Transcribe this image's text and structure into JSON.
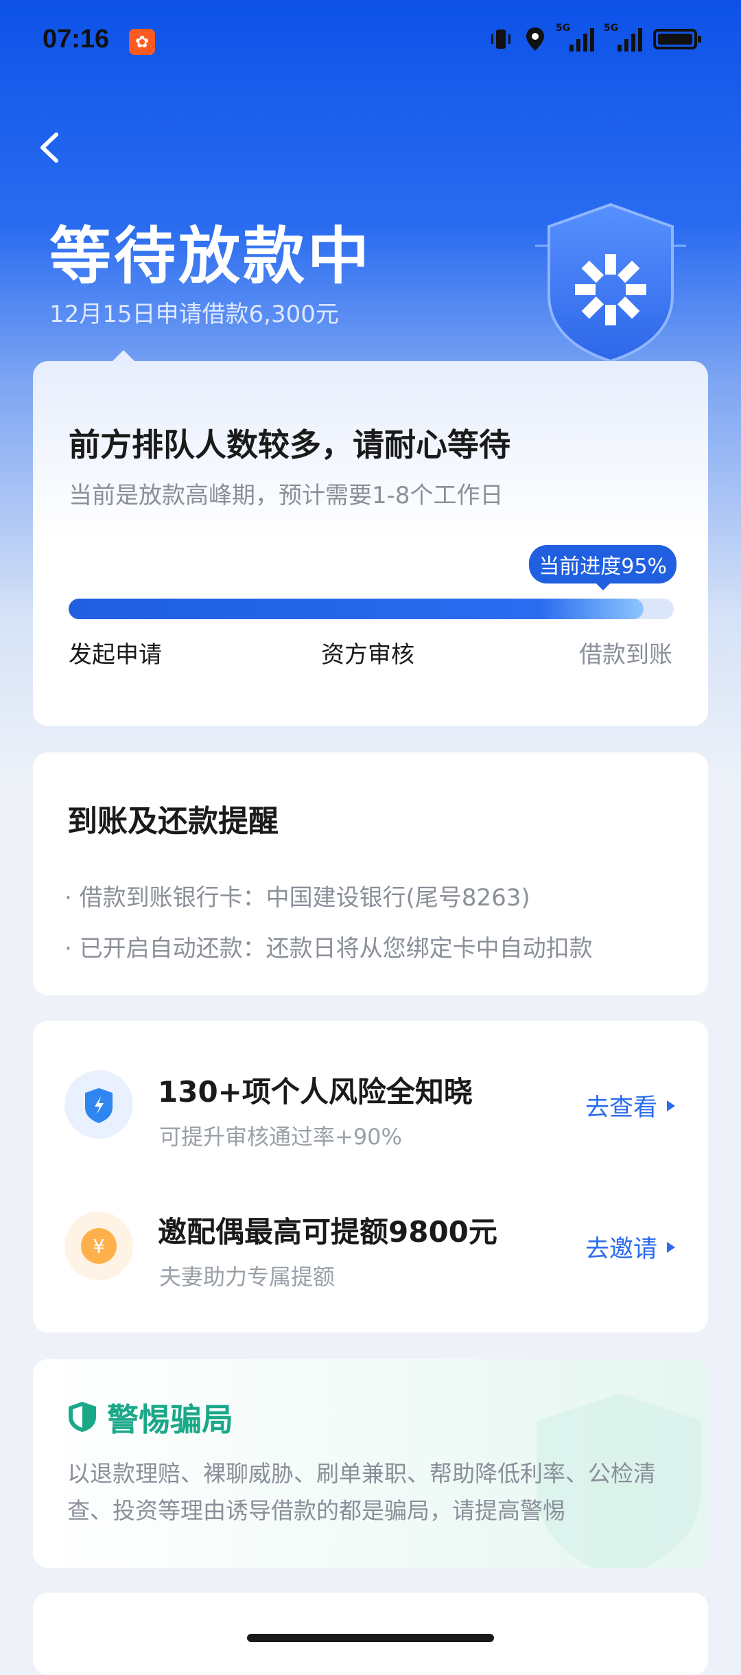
{
  "status_bar": {
    "time": "07:16",
    "network_1": "5G",
    "network_2": "5G"
  },
  "header": {
    "title": "等待放款中",
    "subtitle": "12月15日申请借款6,300元"
  },
  "progress_card": {
    "title": "前方排队人数较多，请耐心等待",
    "subtitle": "当前是放款高峰期，预计需要1-8个工作日",
    "badge": "当前进度95%",
    "progress_percent": 95,
    "steps": [
      "发起申请",
      "资方审核",
      "借款到账"
    ]
  },
  "reminder_card": {
    "title": "到账及还款提醒",
    "items": [
      "借款到账银行卡：中国建设银行(尾号8263)",
      "已开启自动还款：还款日将从您绑定卡中自动扣款"
    ]
  },
  "features": [
    {
      "title": "130+项个人风险全知晓",
      "subtitle": "可提升审核通过率+90%",
      "link": "去查看",
      "icon": "lightning-shield-icon"
    },
    {
      "title": "邀配偶最高可提额9800元",
      "subtitle": "夫妻助力专属提额",
      "link": "去邀请",
      "icon": "yuan-coin-icon"
    }
  ],
  "fraud_card": {
    "title": "警惕骗局",
    "body": "以退款理赔、裸聊威胁、刷单兼职、帮助降低利率、公检清查、投资等理由诱导借款的都是骗局，请提高警惕"
  },
  "colors": {
    "primary": "#1f5fe0",
    "green": "#1aa889",
    "header_bg": "#0d52e8"
  }
}
